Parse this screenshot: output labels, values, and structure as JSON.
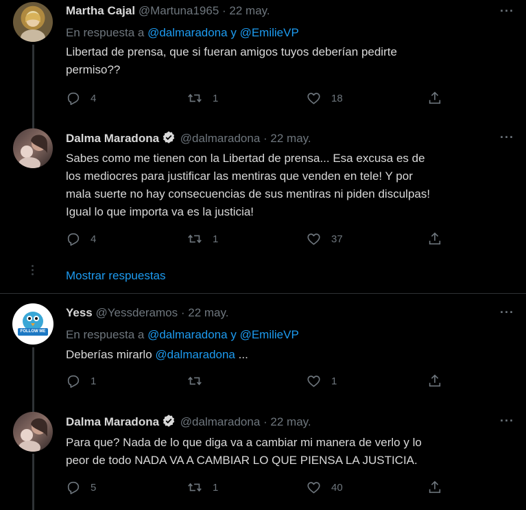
{
  "tweets": [
    {
      "name": "Martha Cajal",
      "handle": "@Martuna1965",
      "date": "· 22 may.",
      "replying_prefix": "En respuesta a",
      "mention1": "@dalmaradona",
      "and": "y",
      "mention2": "@EmilieVP",
      "text_line1": "Libertad de prensa, que si fueran amigos tuyos deberían pedirte",
      "text_line2": "permiso??",
      "replies": "4",
      "retweets": "1",
      "likes": "18"
    },
    {
      "name": "Dalma Maradona",
      "handle": "@dalmaradona",
      "date": "· 22 may.",
      "text_line1": "Sabes como me tienen con la Libertad de prensa... Esa excusa es de",
      "text_line2": "los mediocres para justificar las mentiras que venden en tele! Y por",
      "text_line3": "mala suerte no hay consecuencias de sus mentiras ni piden disculpas!",
      "text_line4": "Igual lo que importa va es la justicia!",
      "replies": "4",
      "retweets": "1",
      "likes": "37"
    },
    {
      "name": "Yess",
      "handle": "@Yessderamos",
      "date": "· 22 may.",
      "avatar_text": "FOLLOW ME",
      "replying_prefix": "En respuesta a",
      "mention1": "@dalmaradona",
      "and": "y",
      "mention2": "@EmilieVP",
      "text_prefix": "Deberías mirarlo",
      "text_mention": "@dalmaradona",
      "text_suffix": "...",
      "replies": "1",
      "retweets": "",
      "likes": "1"
    },
    {
      "name": "Dalma Maradona",
      "handle": "@dalmaradona",
      "date": "· 22 may.",
      "text_line1": "Para que? Nada de lo que diga va a cambiar mi manera de verlo y lo",
      "text_line2": "peor de todo NADA VA A CAMBIAR LO QUE PIENSA LA JUSTICIA.",
      "replies": "5",
      "retweets": "1",
      "likes": "40"
    }
  ],
  "show_replies": "Mostrar respuestas",
  "more_label": "···",
  "colors": {
    "background": "#000000",
    "accent": "#1d9bf0",
    "muted": "#6e767d",
    "text": "#d9d9d9"
  },
  "icons": [
    "reply-icon",
    "retweet-icon",
    "like-icon",
    "share-icon",
    "verified-icon",
    "more-icon"
  ]
}
